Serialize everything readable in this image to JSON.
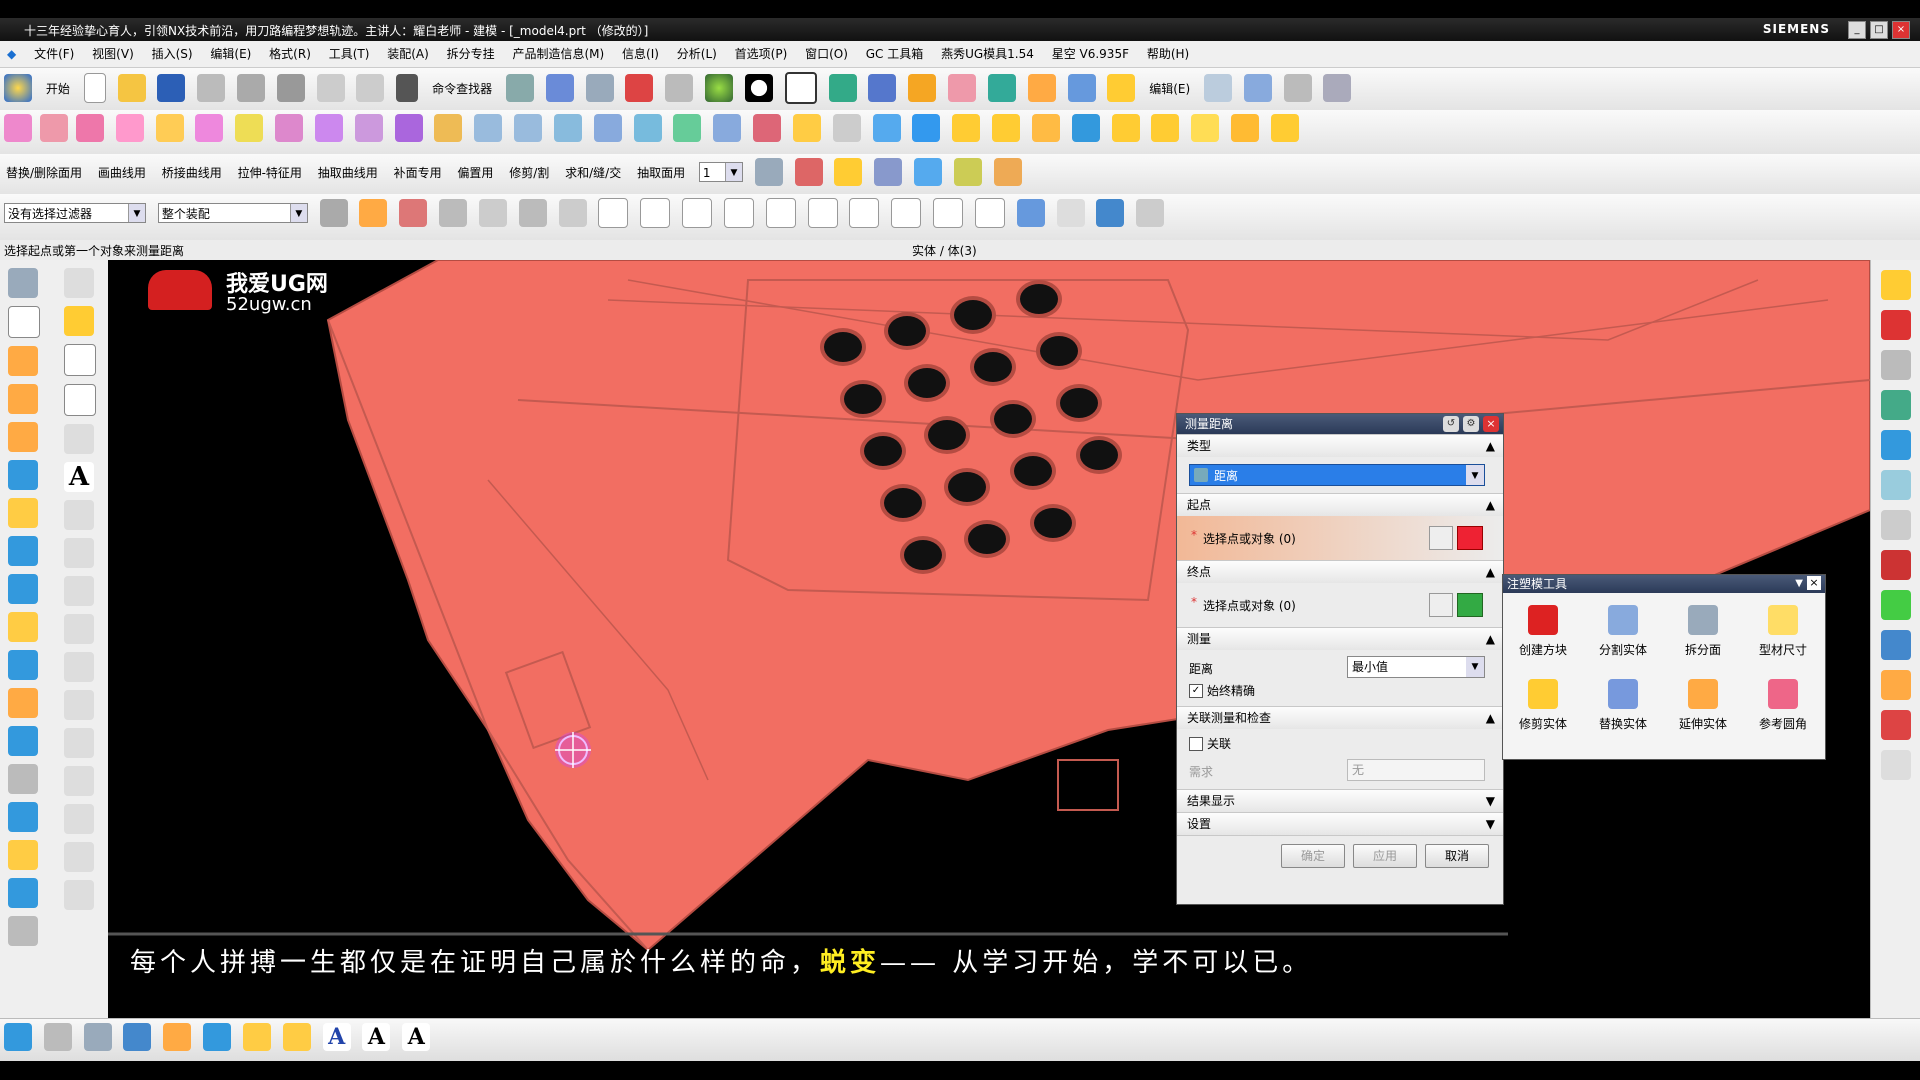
{
  "window": {
    "title": "十三年经验挚心育人，引领NX技术前沿，用刀路编程梦想轨迹。主讲人：耀白老师 - 建模 - [_model4.prt （修改的）]",
    "brand": "SIEMENS"
  },
  "menu": [
    "文件(F)",
    "视图(V)",
    "插入(S)",
    "编辑(E)",
    "格式(R)",
    "工具(T)",
    "装配(A)",
    "拆分专挂",
    "产品制造信息(M)",
    "信息(I)",
    "分析(L)",
    "首选项(P)",
    "窗口(O)",
    "GC 工具箱",
    "燕秀UG模具1.54",
    "星空 V6.935F",
    "帮助(H)"
  ],
  "toolbar1": {
    "start": "开始",
    "cmd_finder": "命令查找器",
    "edit": "编辑(E)"
  },
  "toolbar3": [
    "替换/删除面用",
    "画曲线用",
    "桥接曲线用",
    "拉伸-特征用",
    "抽取曲线用",
    "补面专用",
    "偏置用",
    "修剪/割",
    "求和/缝/交",
    "抽取面用"
  ],
  "toolbar3_combo": "1",
  "filter": {
    "type_filter": "没有选择过滤器",
    "assembly": "整个装配"
  },
  "status": {
    "prompt": "选择起点或第一个对象来测量距离",
    "center": "实体 / 体(3)"
  },
  "logo": {
    "line1": "我爱UG网",
    "line2": "52ugw.cn"
  },
  "dialog": {
    "title": "测量距离",
    "type_section": "类型",
    "type_value": "距离",
    "start_section": "起点",
    "start_select": "选择点或对象 (0)",
    "end_section": "终点",
    "end_select": "选择点或对象 (0)",
    "measure_section": "测量",
    "distance_label": "距离",
    "distance_value": "最小值",
    "always_precise": "始终精确",
    "assoc_section": "关联测量和检查",
    "assoc_label": "关联",
    "need_label": "需求",
    "need_value": "无",
    "result_section": "结果显示",
    "settings_section": "设置",
    "ok": "确定",
    "apply": "应用",
    "cancel": "取消"
  },
  "palette": {
    "title": "注塑模工具",
    "tools": [
      "创建方块",
      "分割实体",
      "拆分面",
      "型材尺寸",
      "修剪实体",
      "替换实体",
      "延伸实体",
      "参考圆角"
    ]
  },
  "subtitle": {
    "before": "每个人拼搏一生都仅是在证明自己属於什么样的命，",
    "highlight": "蜕变",
    "after": "—— 从学习开始，学不可以已。"
  },
  "colors": {
    "model": "#f26e62",
    "accent": "#2b3a58",
    "highlight": "#ffee22"
  }
}
